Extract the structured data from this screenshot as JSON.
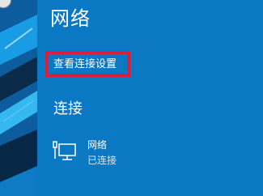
{
  "flyout": {
    "title": "网络",
    "settings_link": "查看连接设置",
    "connections_header": "连接",
    "network": {
      "name": "网络",
      "status": "已连接",
      "icon": "wired-network-icon"
    }
  },
  "colors": {
    "flyout_bg": "#0b78c3",
    "highlight_border": "#d9203a",
    "text": "#ffffff"
  }
}
